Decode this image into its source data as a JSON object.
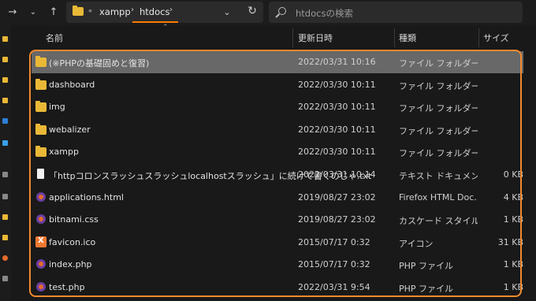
{
  "toolbar": {
    "breadcrumbs": [
      "xampp",
      "htdocs"
    ],
    "search_placeholder": "htdocsの検索"
  },
  "columns": {
    "name": "名前",
    "date": "更新日時",
    "type": "種類",
    "size": "サイズ"
  },
  "colors": {
    "accent": "#f28a2e",
    "folder": "#e9b836",
    "selected": "#686868"
  },
  "files": [
    {
      "name": "(※PHPの基礎固めと復習)",
      "date": "2022/03/31 10:16",
      "type": "ファイル フォルダー",
      "size": "",
      "icon": "folder-icon",
      "selected": true
    },
    {
      "name": "dashboard",
      "date": "2022/03/30 10:11",
      "type": "ファイル フォルダー",
      "size": "",
      "icon": "folder-icon"
    },
    {
      "name": "img",
      "date": "2022/03/30 10:11",
      "type": "ファイル フォルダー",
      "size": "",
      "icon": "folder-icon"
    },
    {
      "name": "webalizer",
      "date": "2022/03/30 10:11",
      "type": "ファイル フォルダー",
      "size": "",
      "icon": "folder-icon"
    },
    {
      "name": "xampp",
      "date": "2022/03/30 10:11",
      "type": "ファイル フォルダー",
      "size": "",
      "icon": "folder-icon"
    },
    {
      "name": "「httpコロンスラッシュスラッシュlocalhostスラッシュ」に続けて書くのじゃ.txt",
      "date": "2022/03/31 10:14",
      "type": "テキスト ドキュメント",
      "size": "0 KB",
      "icon": "text-file-icon"
    },
    {
      "name": "applications.html",
      "date": "2019/08/27 23:02",
      "type": "Firefox HTML Doc...",
      "size": "4 KB",
      "icon": "firefox-icon"
    },
    {
      "name": "bitnami.css",
      "date": "2019/08/27 23:02",
      "type": "カスケード スタイル シ...",
      "size": "1 KB",
      "icon": "firefox-icon"
    },
    {
      "name": "favicon.ico",
      "date": "2015/07/17 0:32",
      "type": "アイコン",
      "size": "31 KB",
      "icon": "xampp-icon"
    },
    {
      "name": "index.php",
      "date": "2015/07/17 0:32",
      "type": "PHP ファイル",
      "size": "1 KB",
      "icon": "firefox-icon"
    },
    {
      "name": "test.php",
      "date": "2022/03/31 9:54",
      "type": "PHP ファイル",
      "size": "1 KB",
      "icon": "firefox-icon"
    }
  ]
}
